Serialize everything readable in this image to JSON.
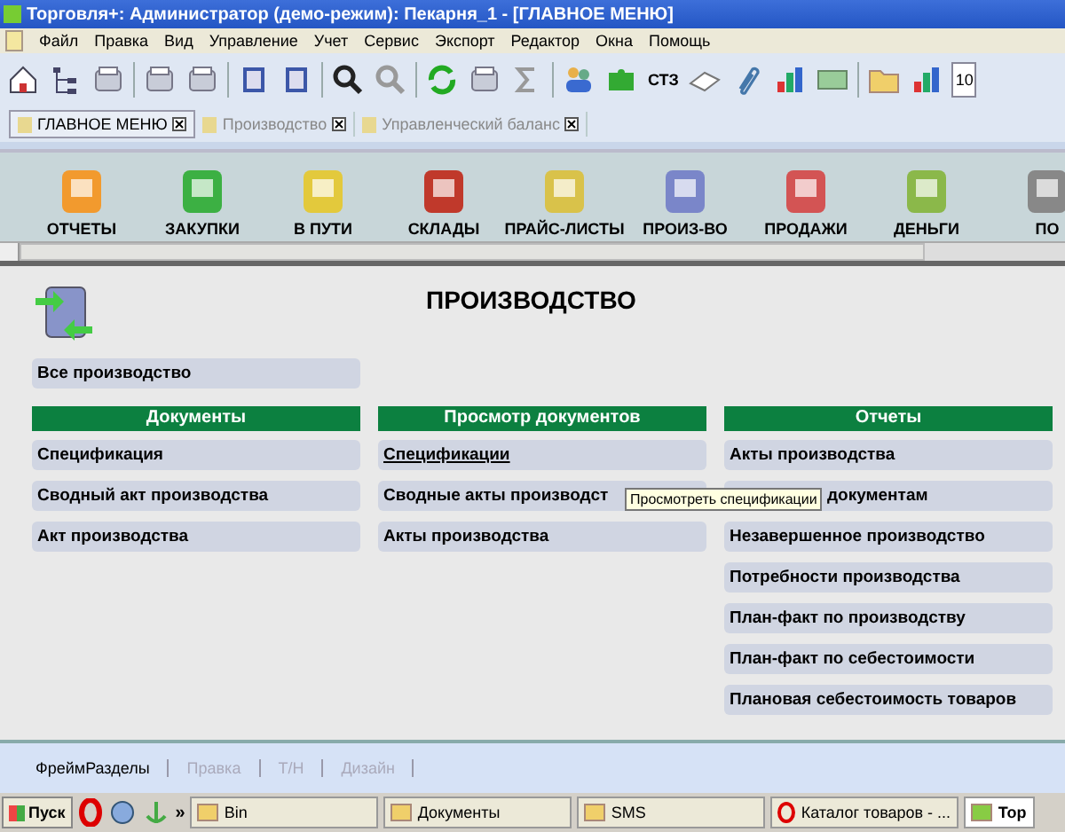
{
  "window": {
    "title": "Торговля+: Администратор (демо-режим): Пекарня_1 - [ГЛАВНОЕ МЕНЮ]"
  },
  "menu": [
    "Файл",
    "Правка",
    "Вид",
    "Управление",
    "Учет",
    "Сервис",
    "Экспорт",
    "Редактор",
    "Окна",
    "Помощь"
  ],
  "toolbar": {
    "text_button": "СТЗ",
    "zoom_value": "10"
  },
  "tabs": [
    {
      "label": "ГЛАВНОЕ МЕНЮ",
      "selected": true
    },
    {
      "label": "Производство",
      "selected": false
    },
    {
      "label": "Управленческий баланс",
      "selected": false
    }
  ],
  "sections": [
    {
      "label": "ОТЧЕТЫ",
      "kind": "reports"
    },
    {
      "label": "ЗАКУПКИ",
      "kind": "purchases"
    },
    {
      "label": "В ПУТИ",
      "kind": "transit"
    },
    {
      "label": "СКЛАДЫ",
      "kind": "warehouses"
    },
    {
      "label": "ПРАЙС-ЛИСТЫ",
      "kind": "prices"
    },
    {
      "label": "ПРОИЗ-ВО",
      "kind": "production"
    },
    {
      "label": "ПРОДАЖИ",
      "kind": "sales"
    },
    {
      "label": "ДЕНЬГИ",
      "kind": "money"
    },
    {
      "label": "ПО",
      "kind": "cut"
    }
  ],
  "page": {
    "title": "ПРОИЗВОДСТВО",
    "all_link": "Все производство",
    "columns": [
      {
        "heading": "Документы",
        "items": [
          {
            "label": "Спецификация",
            "hovered": false,
            "covered_start": false
          },
          {
            "label": "Сводный акт производства",
            "hovered": false,
            "covered_start": false
          },
          {
            "label": "Акт производства",
            "hovered": false,
            "covered_start": false
          }
        ]
      },
      {
        "heading": "Просмотр документов",
        "items": [
          {
            "label": "Спецификации",
            "hovered": true,
            "covered_start": false
          },
          {
            "label": "Сводные акты производст",
            "hovered": false,
            "covered_start": false
          },
          {
            "label": "Акты производства",
            "hovered": false,
            "covered_start": false
          }
        ]
      },
      {
        "heading": "Отчеты",
        "items": [
          {
            "label": "Акты производства",
            "hovered": false,
            "covered_start": false
          },
          {
            "label": "документам",
            "hovered": false,
            "covered_start": true
          },
          {
            "label": "Незавершенное производство",
            "hovered": false,
            "covered_start": false
          },
          {
            "label": "Потребности производства",
            "hovered": false,
            "covered_start": false
          },
          {
            "label": "План-факт по производству",
            "hovered": false,
            "covered_start": false
          },
          {
            "label": "План-факт по себестоимости",
            "hovered": false,
            "covered_start": false
          },
          {
            "label": "Плановая себестоимость товаров",
            "hovered": false,
            "covered_start": false
          }
        ]
      }
    ],
    "tooltip": "Просмотреть спецификации"
  },
  "bottom_tabs": [
    {
      "label": "ФреймРазделы",
      "disabled": false
    },
    {
      "label": "Правка",
      "disabled": true
    },
    {
      "label": "Т/Н",
      "disabled": true
    },
    {
      "label": "Дизайн",
      "disabled": true
    }
  ],
  "taskbar": {
    "start": "Пуск",
    "more": "»",
    "windows": [
      {
        "label": "Bin",
        "kind": "folder",
        "selected": false
      },
      {
        "label": "Документы",
        "kind": "folder",
        "selected": false
      },
      {
        "label": "SMS",
        "kind": "folder",
        "selected": false
      },
      {
        "label": "Каталог товаров - ...",
        "kind": "browser",
        "selected": false
      },
      {
        "label": "Тор",
        "kind": "app",
        "selected": true
      }
    ]
  }
}
